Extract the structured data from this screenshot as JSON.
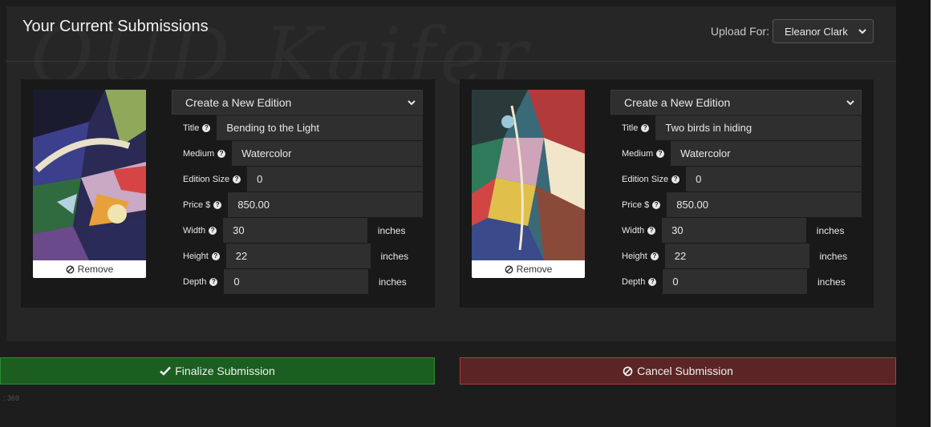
{
  "header": {
    "title": "Your Current Submissions",
    "upload_for_label": "Upload For:",
    "upload_for_value": "Eleanor Clark"
  },
  "labels": {
    "title": "Title",
    "medium": "Medium",
    "edition_size": "Edition Size",
    "price": "Price $",
    "width": "Width",
    "height": "Height",
    "depth": "Depth",
    "unit": "inches",
    "remove": "Remove",
    "help_glyph": "?"
  },
  "submissions": [
    {
      "edition": "Create a New Edition",
      "title": "Bending to the Light",
      "medium": "Watercolor",
      "edition_size": "0",
      "price": "850.00",
      "width": "30",
      "height": "22",
      "depth": "0"
    },
    {
      "edition": "Create a New Edition",
      "title": "Two birds in hiding",
      "medium": "Watercolor",
      "edition_size": "0",
      "price": "850.00",
      "width": "30",
      "height": "22",
      "depth": "0"
    }
  ],
  "actions": {
    "finalize": "Finalize Submission",
    "cancel": "Cancel Submission"
  },
  "footer": {
    "id_text": ": 369"
  },
  "colors": {
    "finalize": "#1b5e20",
    "cancel": "#5a2524",
    "panel": "#262626",
    "card": "#191919"
  },
  "icons": {
    "chevron": "chevron-down-icon",
    "check": "check-icon",
    "ban": "ban-icon",
    "help": "question-circle-icon"
  }
}
